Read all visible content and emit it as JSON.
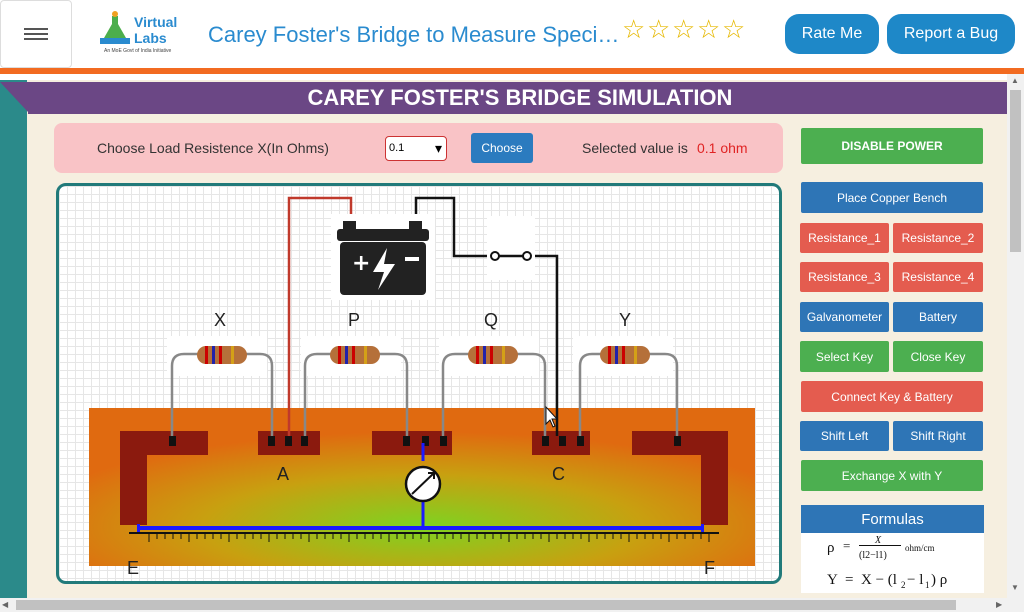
{
  "header": {
    "menu_icon": "hamburger-icon",
    "logo_text": "Virtual Labs",
    "logo_subtext": "An MoE Govt of India Initiative",
    "experiment_title": "Carey Foster's Bridge to Measure Specifi...",
    "rating_stars": 5,
    "rate_button": "Rate Me",
    "bug_button": "Report a Bug"
  },
  "banner": {
    "title": "CAREY FOSTER'S BRIDGE SIMULATION"
  },
  "controls": {
    "load_label": "Choose Load Resistence X(In Ohms)",
    "load_select_value": "0.1",
    "choose_button": "Choose",
    "selected_label": "Selected value is",
    "selected_value": "0.1 ohm"
  },
  "simulation": {
    "resistor_labels": [
      "X",
      "P",
      "Q",
      "Y"
    ],
    "terminal_labels": [
      "A",
      "C"
    ],
    "end_labels": [
      "E",
      "F"
    ]
  },
  "side_panel": {
    "disable_power": "DISABLE POWER",
    "place_copper_bench": "Place Copper Bench",
    "resistance_1": "Resistance_1",
    "resistance_2": "Resistance_2",
    "resistance_3": "Resistance_3",
    "resistance_4": "Resistance_4",
    "galvanometer": "Galvanometer",
    "battery": "Battery",
    "select_key": "Select Key",
    "close_key": "Close Key",
    "connect_key_battery": "Connect Key & Battery",
    "shift_left": "Shift Left",
    "shift_right": "Shift Right",
    "exchange": "Exchange X with Y",
    "formulas_title": "Formulas"
  },
  "colors": {
    "accent": "#1e88c8",
    "header_stripe": "#f26b21",
    "banner": "#6b4785",
    "green_button": "#4caf50",
    "blue_button": "#2e75b6",
    "red_button": "#e45c4f"
  }
}
